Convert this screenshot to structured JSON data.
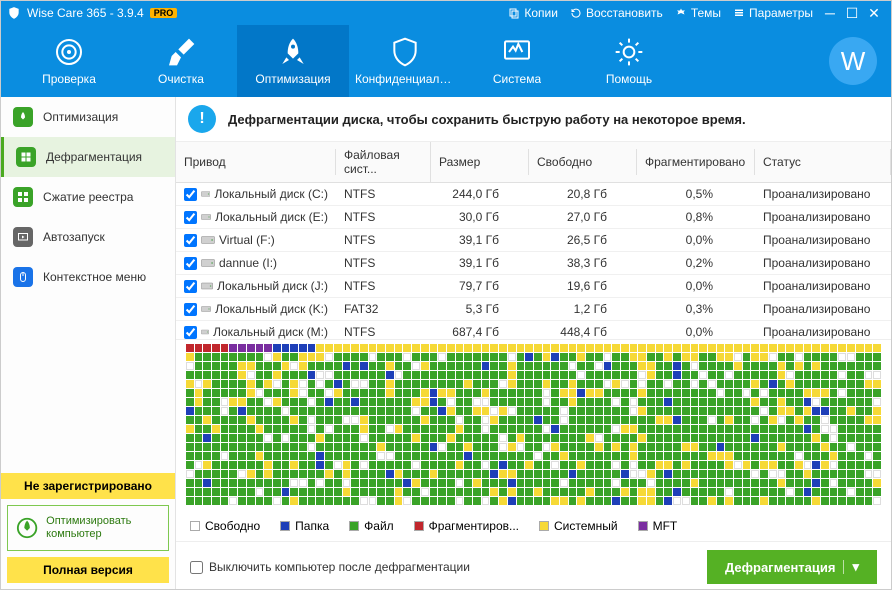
{
  "title": "Wise Care 365 - 3.9.4",
  "badge": "PRO",
  "titlebar_links": {
    "copies": "Копии",
    "restore": "Восстановить",
    "themes": "Темы",
    "params": "Параметры"
  },
  "avatar_initial": "W",
  "tabs": [
    {
      "label": "Проверка"
    },
    {
      "label": "Очистка"
    },
    {
      "label": "Оптимизация"
    },
    {
      "label": "Конфиденциаль..."
    },
    {
      "label": "Система"
    },
    {
      "label": "Помощь"
    }
  ],
  "sidebar": [
    {
      "label": "Оптимизация"
    },
    {
      "label": "Дефрагментация"
    },
    {
      "label": "Сжатие реестра"
    },
    {
      "label": "Автозапуск"
    },
    {
      "label": "Контекстное меню"
    }
  ],
  "not_registered": "Не зарегистрировано",
  "optimize_card": "Оптимизировать компьютер",
  "full_version": "Полная версия",
  "info_text": "Дефрагментации диска, чтобы сохранить быструю работу на некоторое время.",
  "columns": {
    "drive": "Привод",
    "fs": "Файловая сист...",
    "size": "Размер",
    "free": "Свободно",
    "frag": "Фрагментировано",
    "status": "Статус"
  },
  "rows": [
    {
      "drive": "Локальный диск (C:)",
      "fs": "NTFS",
      "size": "244,0 Гб",
      "free": "20,8 Гб",
      "frag": "0,5%",
      "status": "Проанализировано"
    },
    {
      "drive": "Локальный диск (E:)",
      "fs": "NTFS",
      "size": "30,0 Гб",
      "free": "27,0 Гб",
      "frag": "0,8%",
      "status": "Проанализировано"
    },
    {
      "drive": "Virtual  (F:)",
      "fs": "NTFS",
      "size": "39,1 Гб",
      "free": "26,5 Гб",
      "frag": "0,0%",
      "status": "Проанализировано"
    },
    {
      "drive": "dannue (I:)",
      "fs": "NTFS",
      "size": "39,1 Гб",
      "free": "38,3 Гб",
      "frag": "0,2%",
      "status": "Проанализировано"
    },
    {
      "drive": "Локальный диск (J:)",
      "fs": "NTFS",
      "size": "79,7 Гб",
      "free": "19,6 Гб",
      "frag": "0,0%",
      "status": "Проанализировано"
    },
    {
      "drive": "Локальный диск (K:)",
      "fs": "FAT32",
      "size": "5,3 Гб",
      "free": "1,2 Гб",
      "frag": "0,3%",
      "status": "Проанализировано"
    },
    {
      "drive": "Локальный диск (M:)",
      "fs": "NTFS",
      "size": "687,4 Гб",
      "free": "448,4 Гб",
      "frag": "0,0%",
      "status": "Проанализировано"
    }
  ],
  "legend": {
    "free": "Свободно",
    "folder": "Папка",
    "file": "Файл",
    "fragmented": "Фрагментиров...",
    "system": "Системный",
    "mft": "MFT"
  },
  "legend_colors": {
    "free": "#ffffff",
    "folder": "#1e3fb8",
    "file": "#3aa328",
    "fragmented": "#c1272d",
    "system": "#f6d936",
    "mft": "#7a2ea0"
  },
  "shutdown_label": "Выключить компьютер после дефрагментации",
  "defrag_button": "Дефрагментация"
}
